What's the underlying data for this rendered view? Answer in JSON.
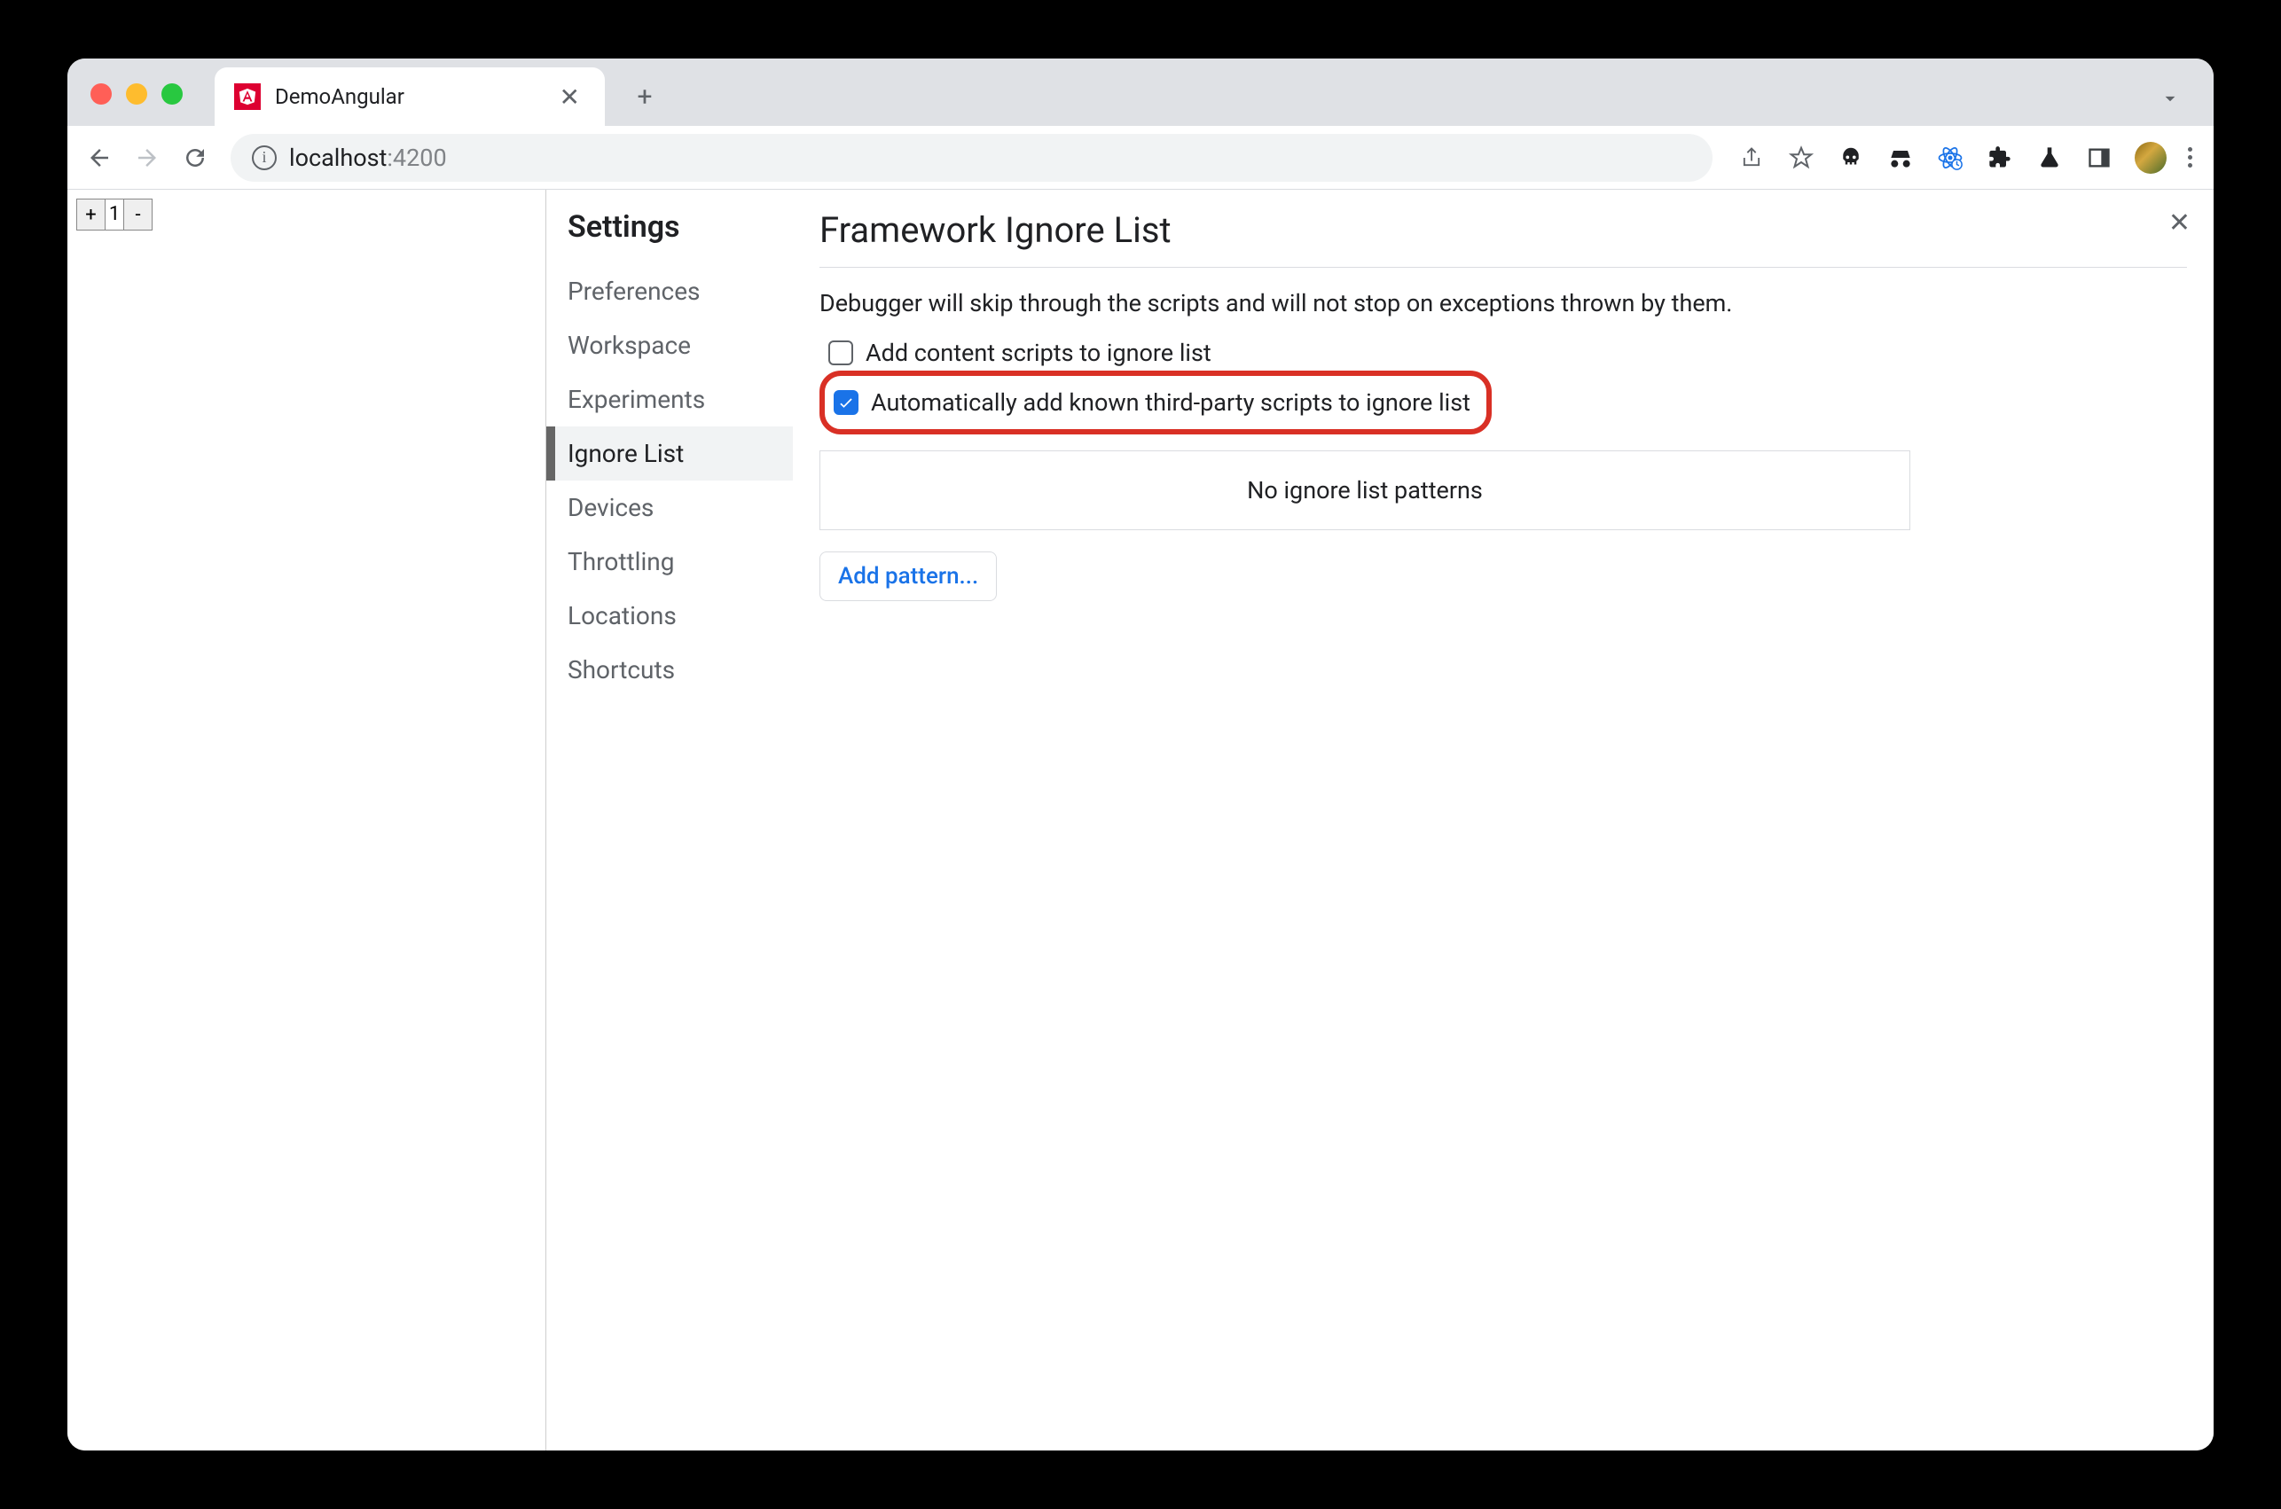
{
  "browser": {
    "tab_title": "DemoAngular",
    "url_host": "localhost",
    "url_port": ":4200"
  },
  "page": {
    "counter_value": "1",
    "plus": "+",
    "minus": "-"
  },
  "settings": {
    "title": "Settings",
    "nav": {
      "preferences": "Preferences",
      "workspace": "Workspace",
      "experiments": "Experiments",
      "ignore_list": "Ignore List",
      "devices": "Devices",
      "throttling": "Throttling",
      "locations": "Locations",
      "shortcuts": "Shortcuts"
    },
    "section_title": "Framework Ignore List",
    "section_desc": "Debugger will skip through the scripts and will not stop on exceptions thrown by them.",
    "checkbox1_label": "Add content scripts to ignore list",
    "checkbox1_checked": false,
    "checkbox2_label": "Automatically add known third-party scripts to ignore list",
    "checkbox2_checked": true,
    "empty_text": "No ignore list patterns",
    "add_pattern_label": "Add pattern..."
  }
}
